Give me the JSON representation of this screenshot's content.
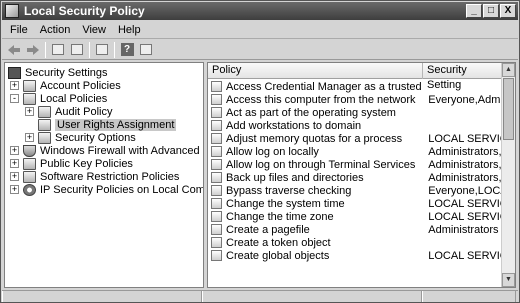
{
  "window": {
    "title": "Local Security Policy",
    "buttons": [
      "_",
      "□",
      "X"
    ]
  },
  "menu": [
    "File",
    "Action",
    "View",
    "Help"
  ],
  "toolbar": {
    "icons": [
      "back-arrow-icon",
      "forward-arrow-icon",
      "up-folder-icon",
      "show-hide-tree-icon",
      "export-list-icon",
      "help-icon",
      "properties-icon"
    ]
  },
  "tree": {
    "items": [
      {
        "label": "Security Settings",
        "expander": "",
        "icon": "computer"
      },
      {
        "label": "Account Policies",
        "expander": "+",
        "icon": "folder"
      },
      {
        "label": "Local Policies",
        "expander": "-",
        "icon": "folder"
      },
      {
        "label": "Audit Policy",
        "expander": "+",
        "icon": "folder"
      },
      {
        "label": "User Rights Assignment",
        "expander": "",
        "icon": "folder",
        "selected": true
      },
      {
        "label": "Security Options",
        "expander": "+",
        "icon": "folder"
      },
      {
        "label": "Windows Firewall with Advanced Security",
        "expander": "+",
        "icon": "shield"
      },
      {
        "label": "Public Key Policies",
        "expander": "+",
        "icon": "folder"
      },
      {
        "label": "Software Restriction Policies",
        "expander": "+",
        "icon": "folder"
      },
      {
        "label": "IP Security Policies on Local Computer",
        "expander": "+",
        "icon": "gear"
      }
    ]
  },
  "list": {
    "columns": [
      "Policy",
      "Security Setting"
    ],
    "rows": [
      {
        "policy": "Access Credential Manager as a trusted caller",
        "setting": ""
      },
      {
        "policy": "Access this computer from the network",
        "setting": "Everyone,Administra"
      },
      {
        "policy": "Act as part of the operating system",
        "setting": ""
      },
      {
        "policy": "Add workstations to domain",
        "setting": ""
      },
      {
        "policy": "Adjust memory quotas for a process",
        "setting": "LOCAL SERVICE,N"
      },
      {
        "policy": "Allow log on locally",
        "setting": "Administrators,Users"
      },
      {
        "policy": "Allow log on through Terminal Services",
        "setting": "Administrators,Remo"
      },
      {
        "policy": "Back up files and directories",
        "setting": "Administrators,Backu"
      },
      {
        "policy": "Bypass traverse checking",
        "setting": "Everyone,LOCAL S"
      },
      {
        "policy": "Change the system time",
        "setting": "LOCAL SERVICE,A"
      },
      {
        "policy": "Change the time zone",
        "setting": "LOCAL SERVICE,A"
      },
      {
        "policy": "Create a pagefile",
        "setting": "Administrators"
      },
      {
        "policy": "Create a token object",
        "setting": ""
      },
      {
        "policy": "Create global objects",
        "setting": "LOCAL SERVICE,N"
      }
    ]
  },
  "colors": {
    "titlebar": "#4a4a4a",
    "selection": "#c8c8c8"
  }
}
